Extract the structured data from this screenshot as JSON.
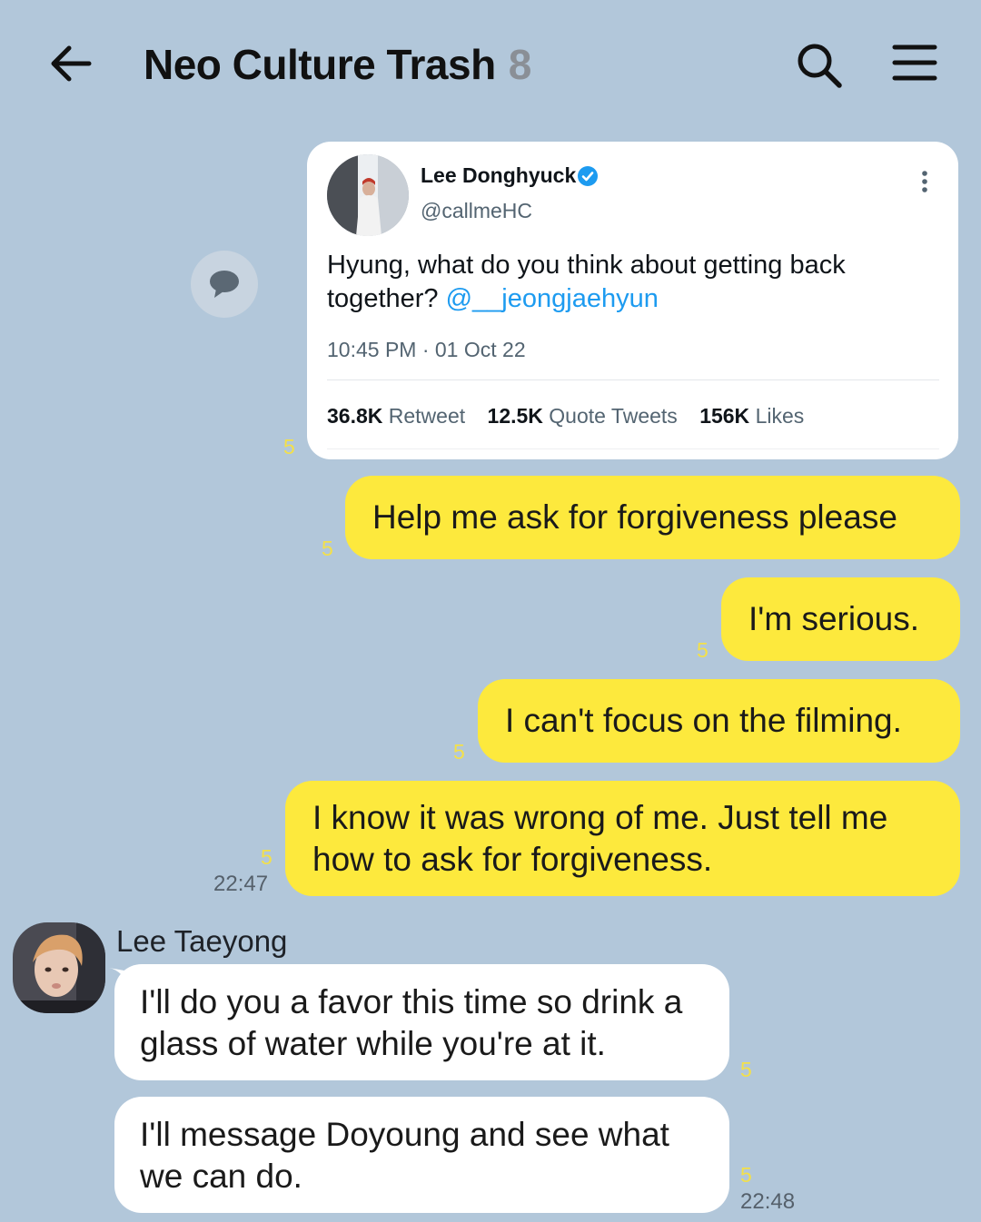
{
  "header": {
    "title": "Neo Culture Trash",
    "member_count": "8",
    "back_icon": "arrow-left-icon",
    "search_icon": "search-icon",
    "menu_icon": "hamburger-menu-icon"
  },
  "tweet": {
    "author_name": "Lee Donghyuck",
    "handle": "@callmeHC",
    "verified": true,
    "text": "Hyung, what do you think about getting back together?",
    "mention": "@__jeongjaehyun",
    "timestamp": "10:45 PM · 01 Oct 22",
    "stats": {
      "retweets_count": "36.8K",
      "retweets_label": "Retweet",
      "quotes_count": "12.5K",
      "quotes_label": "Quote Tweets",
      "likes_count": "156K",
      "likes_label": "Likes"
    },
    "unread": "5"
  },
  "sent_messages": [
    {
      "text": "Help me ask for forgiveness please",
      "unread": "5"
    },
    {
      "text": "I'm serious.",
      "unread": "5"
    },
    {
      "text": "I can't focus on the filming.",
      "unread": "5"
    },
    {
      "text": "I know it was wrong of me. Just tell me how to ask for forgiveness.",
      "unread": "5",
      "time": "22:47"
    }
  ],
  "received": {
    "sender": "Lee Taeyong",
    "messages": [
      {
        "text": "I'll do you a favor this time so drink a glass of water while you're at it.",
        "unread": "5"
      },
      {
        "text": "I'll message Doyoung and see what we can do.",
        "unread": "5",
        "time": "22:48"
      }
    ]
  },
  "colors": {
    "background": "#b2c7da",
    "sent_bubble": "#fde93d",
    "received_bubble": "#ffffff",
    "unread_count": "#f3e04a",
    "twitter_blue": "#1d9bf0"
  }
}
